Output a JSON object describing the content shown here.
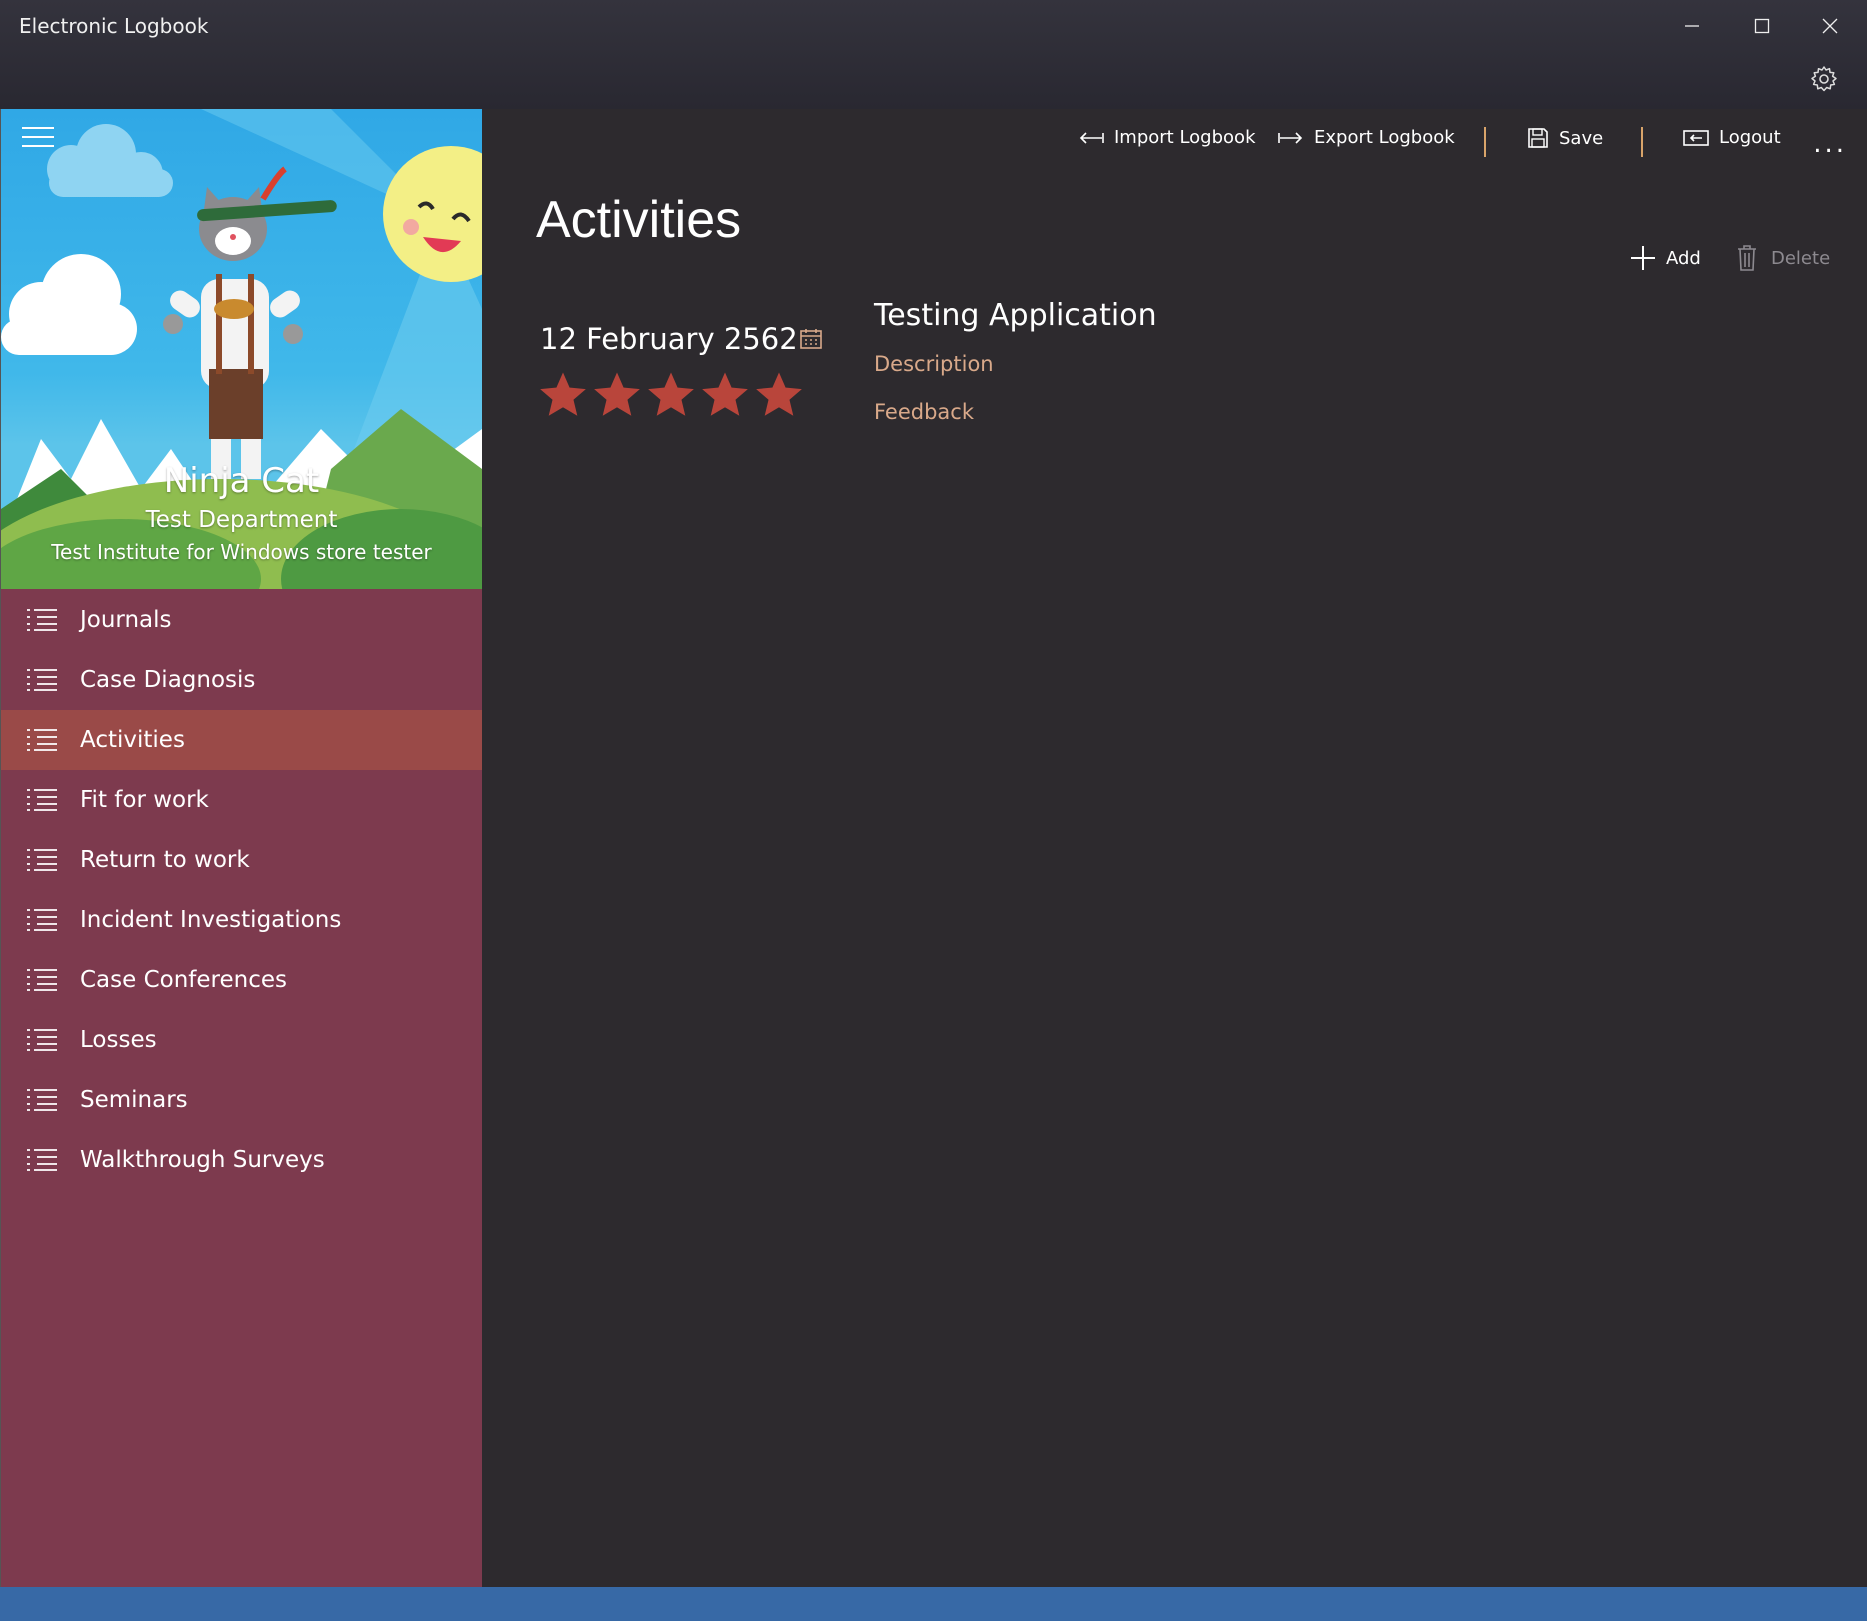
{
  "window": {
    "title": "Electronic Logbook"
  },
  "profile": {
    "name": "Ninja Cat",
    "department": "Test Department",
    "institute": "Test Institute for Windows store tester"
  },
  "nav": {
    "items": [
      {
        "label": "Journals"
      },
      {
        "label": "Case Diagnosis"
      },
      {
        "label": "Activities"
      },
      {
        "label": "Fit for work"
      },
      {
        "label": "Return to work"
      },
      {
        "label": "Incident Investigations"
      },
      {
        "label": "Case Conferences"
      },
      {
        "label": "Losses"
      },
      {
        "label": "Seminars"
      },
      {
        "label": "Walkthrough Surveys"
      }
    ],
    "selected": "Activities"
  },
  "commandbar": {
    "import_label": "Import Logbook",
    "export_label": "Export Logbook",
    "save_label": "Save",
    "logout_label": "Logout",
    "more_label": "..."
  },
  "page": {
    "title": "Activities",
    "add_label": "Add",
    "delete_label": "Delete"
  },
  "activity": {
    "date": "12 February 2562",
    "rating": 5,
    "rating_max": 5,
    "title": "Testing Application",
    "description": "Description",
    "feedback": "Feedback"
  },
  "colors": {
    "sidebar": "#7d3a4e",
    "selected_item": "#9a4a48",
    "star": "#b9453b",
    "accent_text": "#d9a98a",
    "statusbar": "#3769a6"
  }
}
